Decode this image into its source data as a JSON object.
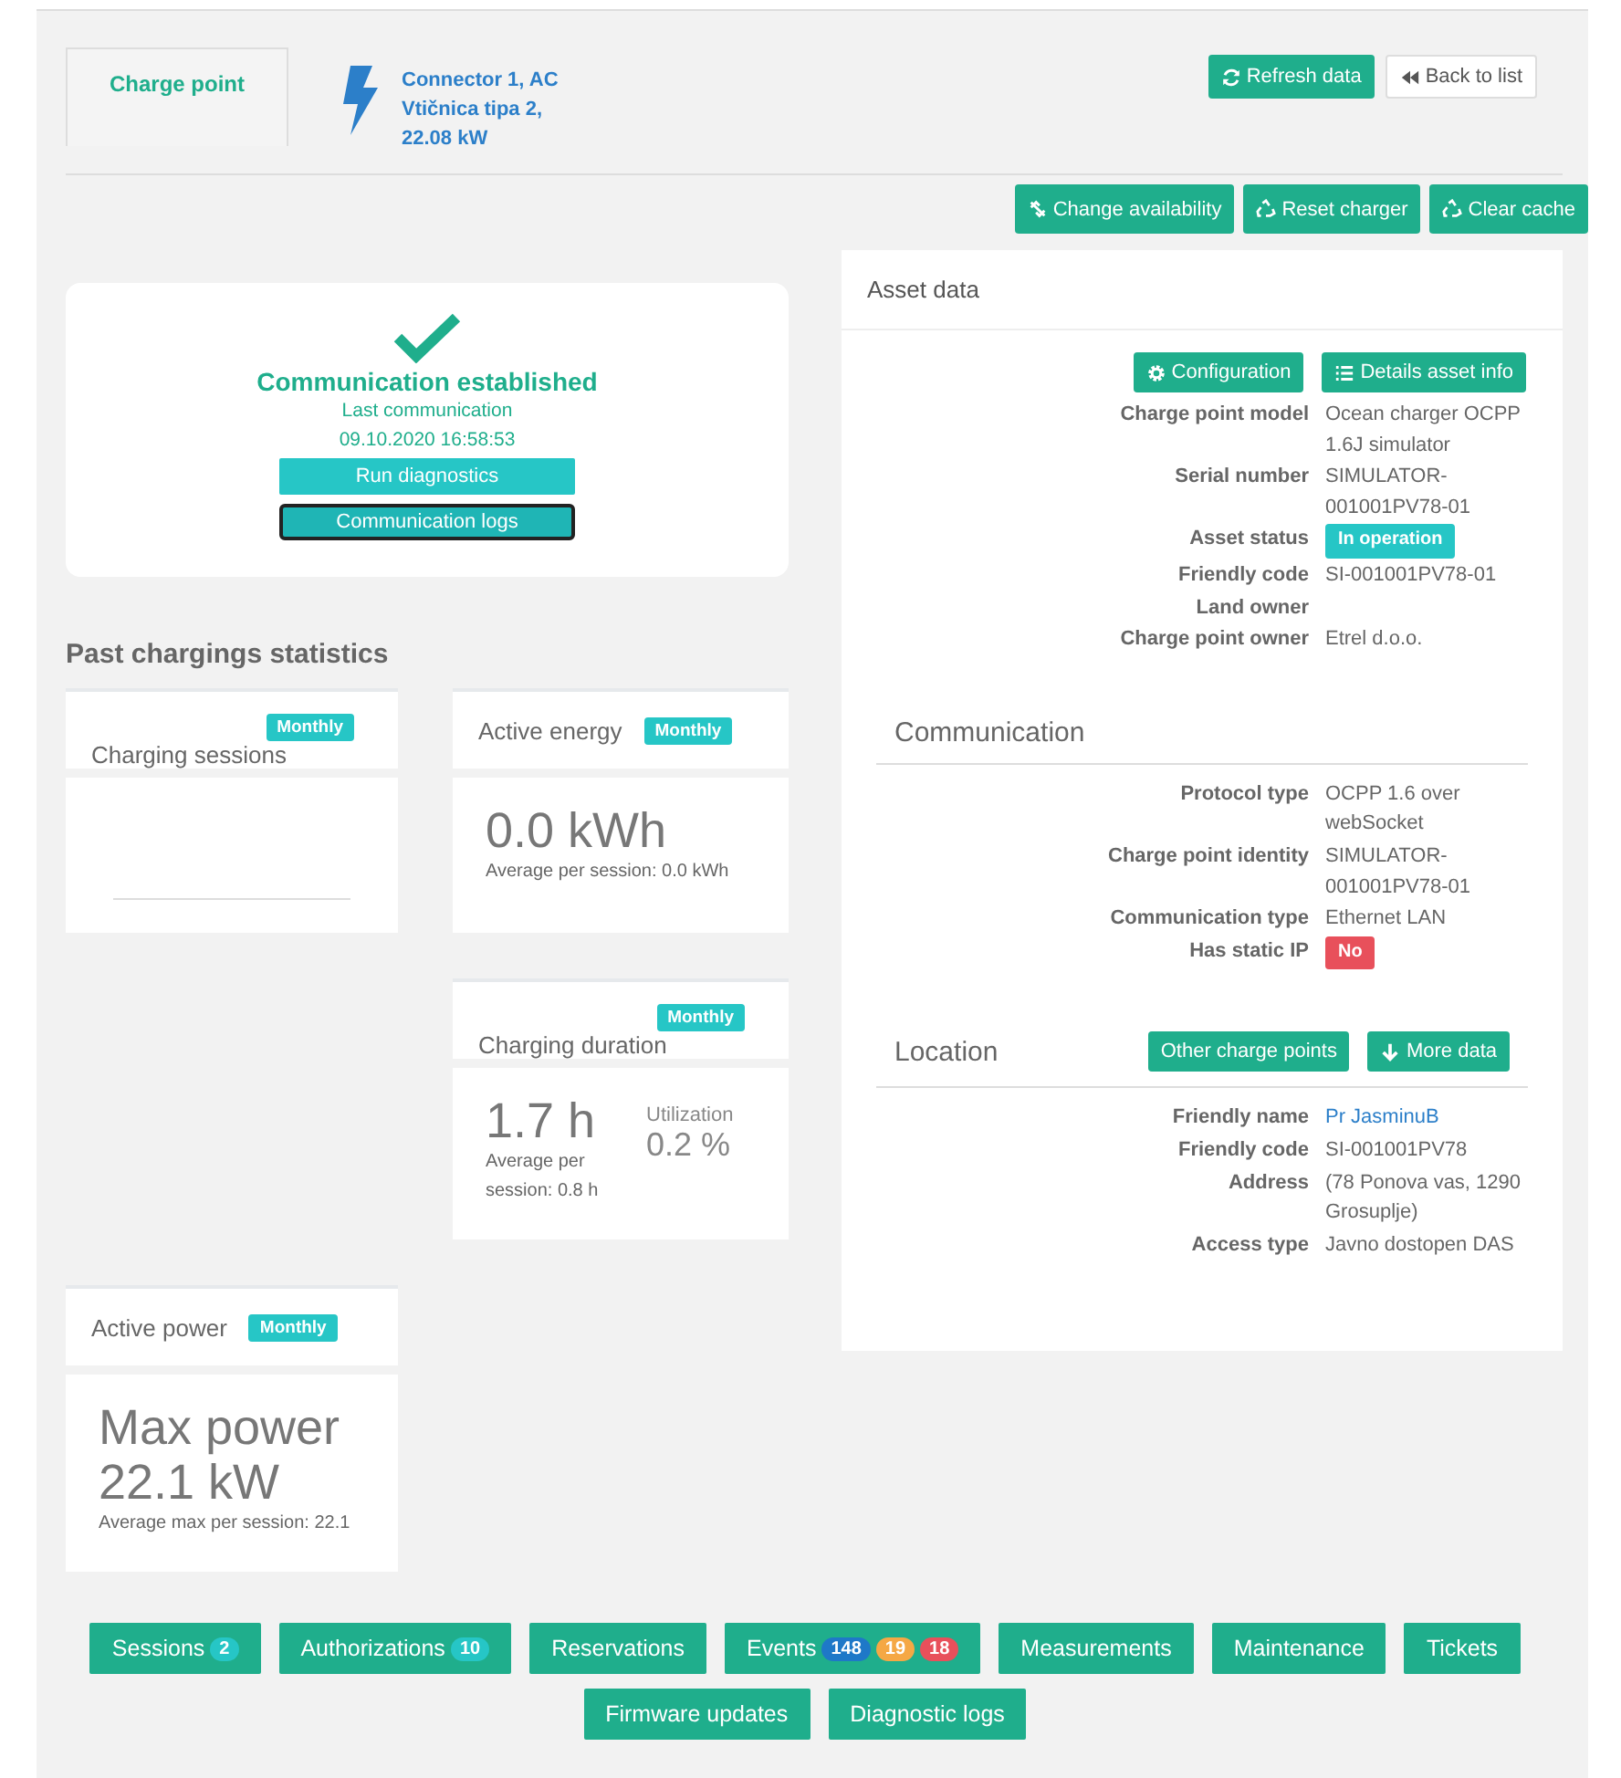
{
  "header": {
    "tab": {
      "label": "Charge point",
      "selected": true
    },
    "connector": {
      "lines": [
        "Connector 1, AC",
        "Vtičnica tipa 2,",
        "22.08 kW"
      ]
    },
    "buttons": [
      {
        "label": "Refresh data",
        "kind": "refresh"
      },
      {
        "label": "Back to list",
        "kind": "back"
      }
    ]
  },
  "actions": [
    {
      "label": "Change availability",
      "kind": "unlink"
    },
    {
      "label": "Reset charger",
      "kind": "recycle"
    },
    {
      "label": "Clear cache",
      "kind": "recycle"
    }
  ],
  "communication": {
    "status": "Communication established",
    "last_label": "Last communication",
    "last_time": "09.10.2020 16:58:53",
    "buttons": [
      {
        "label": "Run diagnostics",
        "selected": false
      },
      {
        "label": "Communication logs",
        "selected": true
      }
    ]
  },
  "statistics": {
    "title": "Past chargings statistics",
    "cards": [
      {
        "kind": "empty",
        "title": "Charging sessions",
        "period": "Monthly",
        "stacked": true
      },
      {
        "kind": "value",
        "title": "Active energy",
        "period": "Monthly",
        "stacked": false,
        "value": "0.0 kWh",
        "note": "Average per session: 0.0 kWh"
      },
      {
        "kind": "split",
        "title": "Charging duration",
        "period": "Monthly",
        "stacked": true,
        "value": "1.7 h",
        "note": "Average per session: 0.8 h",
        "side_label": "Utilization",
        "side_value": "0.2 %"
      },
      {
        "kind": "value",
        "title": "Active power",
        "period": "Monthly",
        "stacked": false,
        "value": "Max power 22.1 kW",
        "note": "Average max per session: 22.1"
      }
    ]
  },
  "asset_data": {
    "title": "Asset data",
    "buttons": [
      {
        "label": "Configuration",
        "kind": "gear"
      },
      {
        "label": "Details asset info",
        "kind": "list"
      }
    ],
    "fields": [
      {
        "label": "Charge point model",
        "kind": "text",
        "value": "Ocean charger OCPP 1.6J simulator"
      },
      {
        "label": "Serial number",
        "kind": "text",
        "value": "SIMULATOR-001001PV78-01"
      },
      {
        "label": "Asset status",
        "kind": "badge",
        "value": "In operation",
        "color": "#26c6c6"
      },
      {
        "label": "Friendly code",
        "kind": "text",
        "value": "SI-001001PV78-01"
      },
      {
        "label": "Land owner"
      },
      {
        "label": "Charge point owner",
        "kind": "text",
        "value": "Etrel d.o.o."
      }
    ],
    "sections": [
      {
        "title": "Communication",
        "fields": [
          {
            "label": "Protocol type",
            "kind": "text",
            "value": "OCPP 1.6 over webSocket"
          },
          {
            "label": "Charge point identity",
            "kind": "text",
            "value": "SIMULATOR-001001PV78-01"
          },
          {
            "label": "Communication type",
            "kind": "text",
            "value": "Ethernet LAN"
          },
          {
            "label": "Has static IP",
            "kind": "badge",
            "value": "No",
            "color": "#e8505b"
          }
        ]
      },
      {
        "title": "Location",
        "buttons": [
          {
            "label": "Other charge points",
            "kind": "plain"
          },
          {
            "label": "More data",
            "kind": "down"
          }
        ],
        "fields": [
          {
            "label": "Friendly name",
            "kind": "link",
            "value": "Pr JasminuB"
          },
          {
            "label": "Friendly code",
            "kind": "text",
            "value": "SI-001001PV78"
          },
          {
            "label": "Address",
            "kind": "text",
            "value": "(78 Ponova vas, 1290 Grosuplje)"
          },
          {
            "label": "Access type",
            "kind": "text",
            "value": "Javno dostopen DAS"
          }
        ]
      }
    ]
  },
  "nav": [
    {
      "label": "Sessions",
      "counts": [
        {
          "text": "2",
          "color": "#26c6c6"
        }
      ]
    },
    {
      "label": "Authorizations",
      "counts": [
        {
          "text": "10",
          "color": "#26c6c6"
        }
      ]
    },
    {
      "label": "Reservations"
    },
    {
      "label": "Events",
      "counts": [
        {
          "text": "148",
          "color": "#1e78c8"
        },
        {
          "text": "19",
          "color": "#f5a845"
        },
        {
          "text": "18",
          "color": "#e8505b"
        }
      ]
    },
    {
      "label": "Measurements"
    },
    {
      "label": "Maintenance"
    },
    {
      "label": "Tickets"
    },
    {
      "label": "Firmware updates"
    },
    {
      "label": "Diagnostic logs"
    }
  ]
}
